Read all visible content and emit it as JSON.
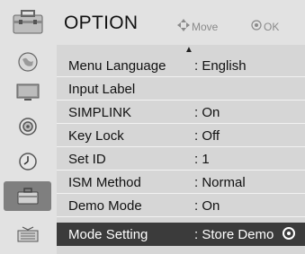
{
  "header": {
    "title": "OPTION",
    "hint_move": "Move",
    "hint_ok": "OK"
  },
  "sidebar": {
    "categories": [
      {
        "name": "option",
        "icon": "toolbox-icon",
        "active": false
      },
      {
        "name": "picture",
        "icon": "globe-icon",
        "active": false
      },
      {
        "name": "screen",
        "icon": "monitor-icon",
        "active": false
      },
      {
        "name": "audio",
        "icon": "speaker-icon",
        "active": false
      },
      {
        "name": "time",
        "icon": "clock-icon",
        "active": false
      },
      {
        "name": "option",
        "icon": "toolbox-icon",
        "active": true
      },
      {
        "name": "input",
        "icon": "input-icon",
        "active": false
      }
    ]
  },
  "menu": {
    "items": [
      {
        "label": "Menu Language",
        "value": ": English"
      },
      {
        "label": "Input Label",
        "value": ""
      },
      {
        "label": "SIMPLINK",
        "value": ": On"
      },
      {
        "label": "Key Lock",
        "value": ": Off"
      },
      {
        "label": "Set ID",
        "value": ": 1"
      },
      {
        "label": "ISM Method",
        "value": ": Normal"
      },
      {
        "label": "Demo Mode",
        "value": ": On"
      },
      {
        "label": "Mode Setting",
        "value": ": Store Demo"
      }
    ],
    "selected_index": 7
  },
  "colors": {
    "panel_light": "#e2e2e2",
    "panel_row": "#d6d6d6",
    "selected_row": "#3b3b3b",
    "active_category": "#7f7f7f"
  }
}
